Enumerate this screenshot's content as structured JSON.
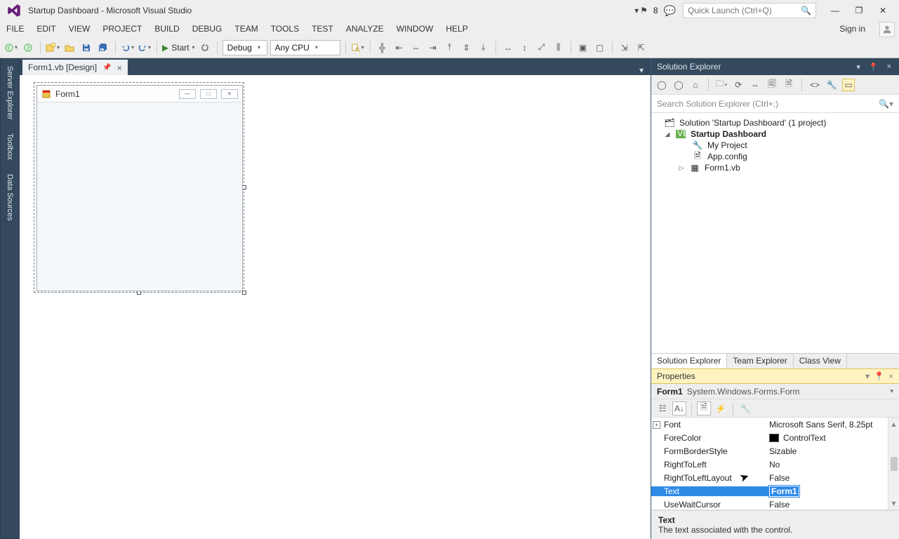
{
  "title": "Startup Dashboard - Microsoft Visual Studio",
  "quick_launch_placeholder": "Quick Launch (Ctrl+Q)",
  "notif_count": "8",
  "menu": [
    "FILE",
    "EDIT",
    "VIEW",
    "PROJECT",
    "BUILD",
    "DEBUG",
    "TEAM",
    "TOOLS",
    "TEST",
    "ANALYZE",
    "WINDOW",
    "HELP"
  ],
  "sign_in": "Sign in",
  "toolbar": {
    "start_label": "Start",
    "config": "Debug",
    "platform": "Any CPU"
  },
  "left_rail": [
    "Server Explorer",
    "Toolbox",
    "Data Sources"
  ],
  "doc_tab": {
    "name": "Form1.vb [Design]"
  },
  "designer_form": {
    "title": "Form1"
  },
  "solution_explorer": {
    "header": "Solution Explorer",
    "search_placeholder": "Search Solution Explorer (Ctrl+;)",
    "solution_line": "Solution 'Startup Dashboard' (1 project)",
    "project_name": "Startup Dashboard",
    "items": [
      "My Project",
      "App.config",
      "Form1.vb"
    ],
    "tabs": [
      "Solution Explorer",
      "Team Explorer",
      "Class View"
    ]
  },
  "properties": {
    "header": "Properties",
    "object_name": "Form1",
    "object_type": "System.Windows.Forms.Form",
    "rows": [
      {
        "k": "Font",
        "v": "Microsoft Sans Serif, 8.25pt",
        "exp": true
      },
      {
        "k": "ForeColor",
        "v": "ControlText",
        "swatch": true
      },
      {
        "k": "FormBorderStyle",
        "v": "Sizable"
      },
      {
        "k": "RightToLeft",
        "v": "No"
      },
      {
        "k": "RightToLeftLayout",
        "v": "False"
      },
      {
        "k": "Text",
        "v": "Form1",
        "selected": true
      },
      {
        "k": "UseWaitCursor",
        "v": "False"
      }
    ],
    "desc_name": "Text",
    "desc_text": "The text associated with the control."
  }
}
